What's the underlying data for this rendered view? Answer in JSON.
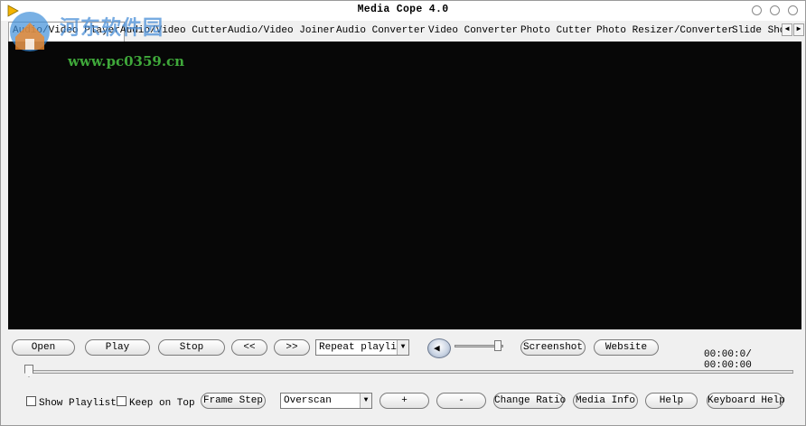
{
  "window": {
    "title": "Media Cope 4.0"
  },
  "watermark": {
    "brand": "河东软件园",
    "url": "www.pc0359.cn"
  },
  "tabs": [
    {
      "label": "Audio/Video Player"
    },
    {
      "label": "Audio/Video Cutter"
    },
    {
      "label": "Audio/Video Joiner"
    },
    {
      "label": "Audio Converter"
    },
    {
      "label": "Video Converter"
    },
    {
      "label": "Photo Cutter"
    },
    {
      "label": "Photo Resizer/Converter"
    },
    {
      "label": "Slide Sho"
    }
  ],
  "controls": {
    "open": "Open",
    "play": "Play",
    "stop": "Stop",
    "prev": "<<",
    "next": ">>",
    "repeat_select": "Repeat playli:",
    "screenshot": "Screenshot",
    "website": "Website",
    "time": "00:00:0/ 00:00:00",
    "volume_percent": 95,
    "seek_percent": 0
  },
  "options": {
    "show_playlist": "Show Playlist",
    "keep_on_top": "Keep on Top",
    "frame_step": "Frame Step",
    "scan_select": "Overscan",
    "plus": "+",
    "minus": "-",
    "change_ratio": "Change Ratio",
    "media_info": "Media Info",
    "help": "Help",
    "keyboard_help": "Keyboard Help"
  },
  "colors": {
    "video_bg": "#070707",
    "watermark_text": "#4a8fd8",
    "watermark_url": "#3fa83a"
  }
}
